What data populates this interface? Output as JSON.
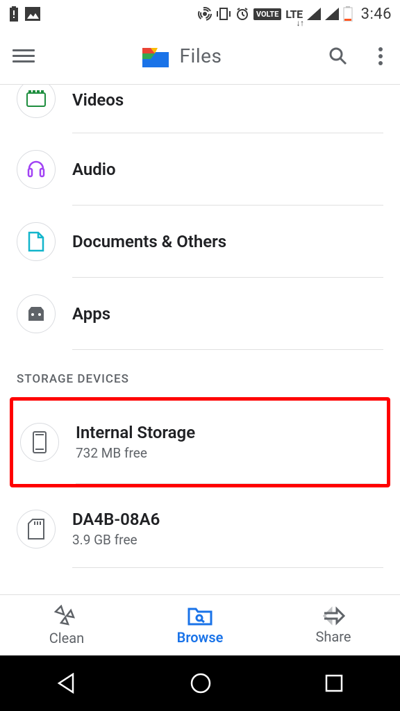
{
  "status": {
    "time": "3:46"
  },
  "app": {
    "title": "Files"
  },
  "categories": [
    {
      "label": "Videos"
    },
    {
      "label": "Audio"
    },
    {
      "label": "Documents & Others"
    },
    {
      "label": "Apps"
    }
  ],
  "storage_section_header": "STORAGE DEVICES",
  "storage_devices": [
    {
      "title": "Internal Storage",
      "sub": "732 MB free"
    },
    {
      "title": "DA4B-08A6",
      "sub": "3.9 GB free"
    }
  ],
  "bottom_nav": {
    "clean": "Clean",
    "browse": "Browse",
    "share": "Share"
  }
}
